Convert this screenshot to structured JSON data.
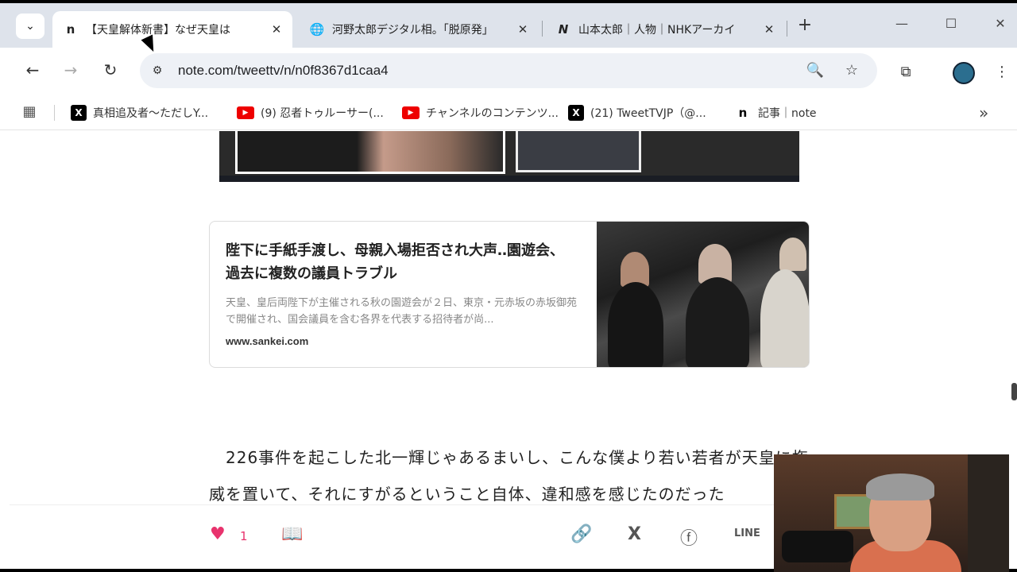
{
  "tabs": [
    {
      "favicon": "n",
      "title": "【天皇解体新書】なぜ天皇は",
      "active": true
    },
    {
      "favicon": "globe-icon",
      "title": "河野太郎デジタル相。「脱原発」",
      "active": false
    },
    {
      "favicon": "N",
      "title": "山本太郎｜人物｜NHKアーカイ",
      "active": false
    }
  ],
  "toolbar": {
    "url": "note.com/tweettv/n/n0f8367d1caa4"
  },
  "bookmarks": [
    {
      "icon": "x",
      "label": "真相追及者〜ただしY..."
    },
    {
      "icon": "youtube",
      "label": "(9) 忍者トゥルーサー(..."
    },
    {
      "icon": "youtube",
      "label": "チャンネルのコンテンツ..."
    },
    {
      "icon": "x",
      "label": "(21) TweetTVJP（@..."
    },
    {
      "icon": "n",
      "label": "記事｜note"
    }
  ],
  "card": {
    "title": "陛下に手紙手渡し、母親入場拒否され大声‥園遊会、過去に複数の議員トラブル",
    "description": "天皇、皇后両陛下が主催される秋の園遊会が２日、東京・元赤坂の赤坂御苑で開催され、国会議員を含む各界を代表する招待者が尚...",
    "domain": "www.sankei.com"
  },
  "body": {
    "paragraph": "　226事件を起こした北一輝じゃあるまいし、こんな僕より若い若者が天皇に権威を置いて、それにすがるということ自体、違和感を感じたのだった"
  },
  "actions": {
    "like_count": "1"
  }
}
